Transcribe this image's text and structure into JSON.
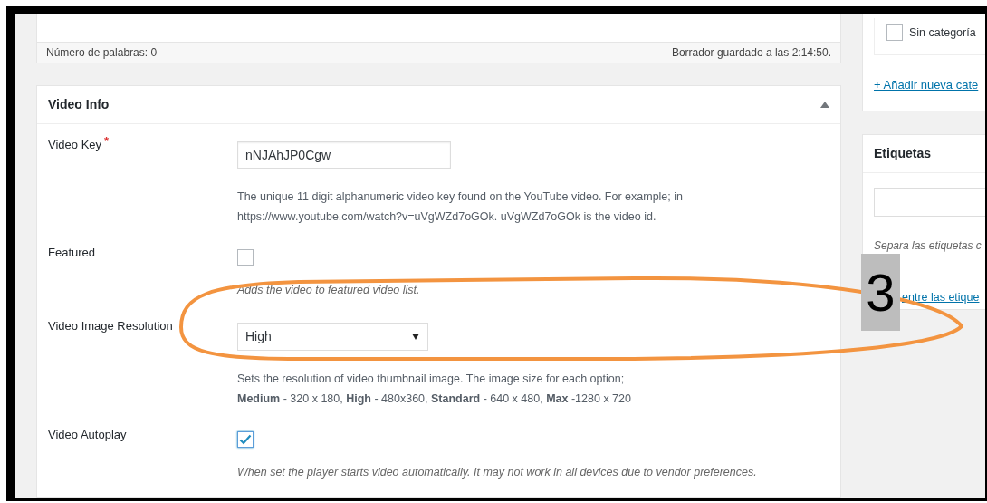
{
  "editor_footer": {
    "word_count": "Número de palabras: 0",
    "draft_status": "Borrador guardado a las 2:14:50."
  },
  "video_info": {
    "title": "Video Info",
    "expanded": true,
    "fields": [
      {
        "kind": "text",
        "label": "Video Key",
        "required_mark": "*",
        "value": "nNJAhJP0Cgw",
        "description": [
          "The unique 11 digit alphanumeric video key found on the YouTube video. For example; in",
          "https://www.youtube.com/watch?v=uVgWZd7oGOk. uVgWZd7oGOk is the video id."
        ]
      },
      {
        "kind": "checkbox",
        "label": "Featured",
        "checked": false,
        "description": [
          "Adds the video to featured video list."
        ]
      },
      {
        "kind": "select",
        "label": "Video Image Resolution",
        "value": "High",
        "description": [
          "Sets the resolution of video thumbnail image. The image size for each option;",
          "**Medium** - 320 x 180, **High** - 480x360, **Standard** - 640 x 480, **Max** -1280 x 720"
        ]
      },
      {
        "kind": "checkbox",
        "label": "Video Autoplay",
        "checked": true,
        "description": [
          "When set the player starts video automatically. It may not work in all devices due to vendor preferences."
        ]
      }
    ]
  },
  "categories": {
    "items": [
      {
        "label": "Sin categoría",
        "checked": false
      }
    ],
    "add_link": "+ Añadir nueva cate"
  },
  "tags": {
    "title": "Etiquetas",
    "hint": "Separa las etiquetas c",
    "link": "entre las etique"
  },
  "annotation": {
    "label": "3"
  }
}
